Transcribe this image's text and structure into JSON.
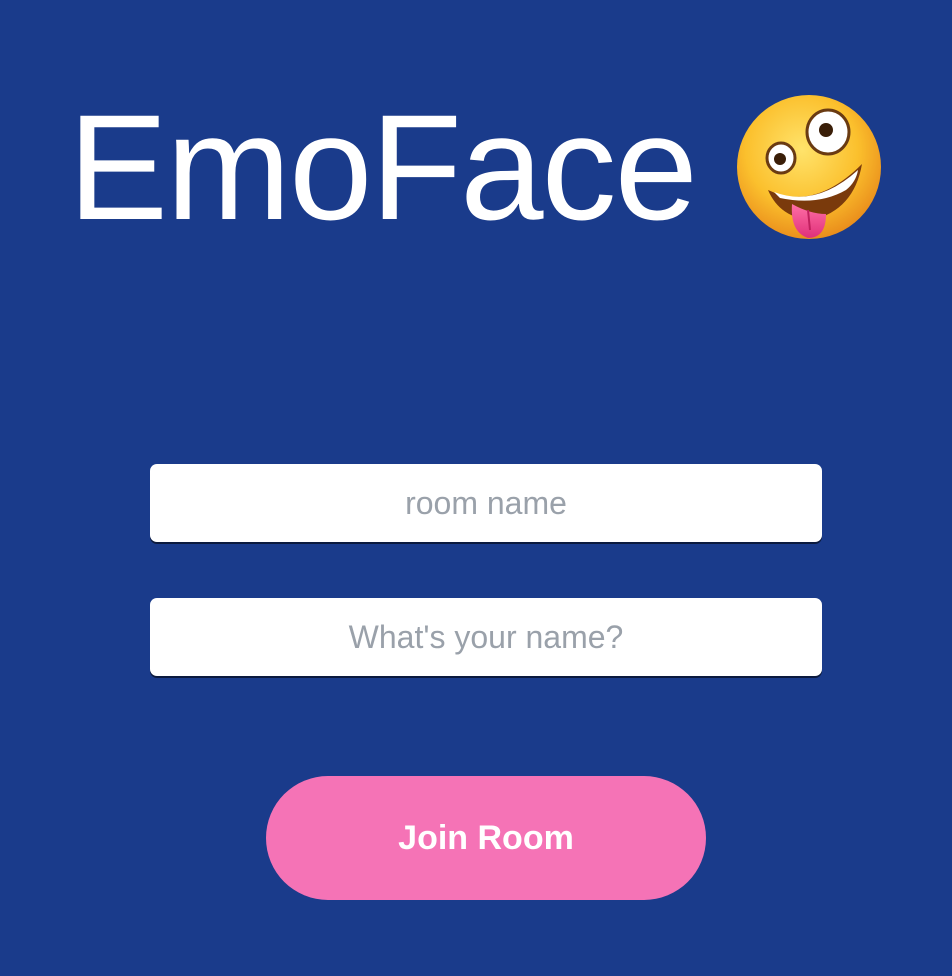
{
  "header": {
    "title": "EmoFace",
    "emoji_icon": "zany-face-icon"
  },
  "form": {
    "room_placeholder": "room name",
    "room_value": "",
    "name_placeholder": "What's your name?",
    "name_value": "",
    "join_label": "Join Room"
  },
  "colors": {
    "background": "#1a3b8b",
    "button": "#f573b6",
    "title_text": "#ffffff",
    "placeholder_text": "#9aa1aa"
  }
}
